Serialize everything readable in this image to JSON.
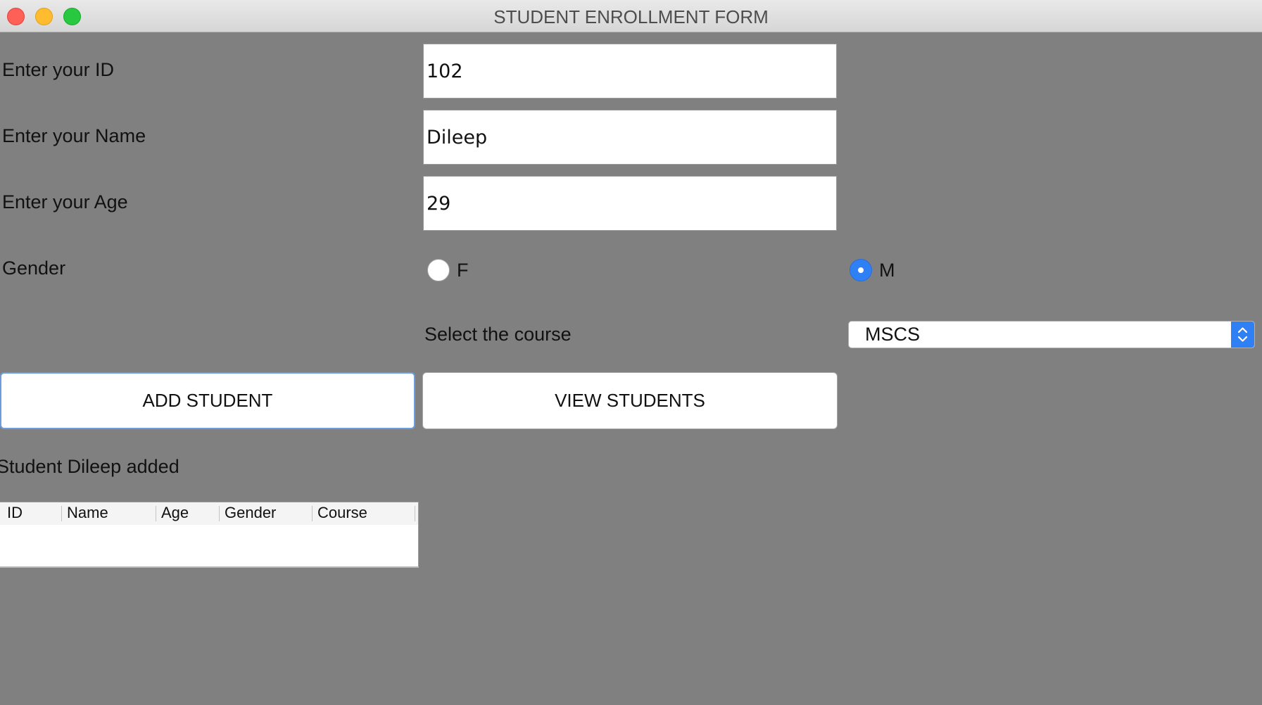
{
  "window": {
    "title": "STUDENT ENROLLMENT FORM"
  },
  "form": {
    "id_label": "Enter your ID",
    "id_value": "102",
    "name_label": "Enter your Name",
    "name_value": "Dileep",
    "age_label": "Enter your Age",
    "age_value": "29",
    "gender_label": "Gender",
    "gender_options": [
      "F",
      "M"
    ],
    "gender_selected": "M",
    "course_label": "Select the course",
    "course_value": "MSCS"
  },
  "buttons": {
    "add_label": "ADD STUDENT",
    "view_label": "VIEW STUDENTS"
  },
  "status": {
    "message": "Student Dileep added"
  },
  "table": {
    "columns": [
      "ID",
      "Name",
      "Age",
      "Gender",
      "Course"
    ],
    "rows": []
  },
  "colors": {
    "background": "#808080",
    "accent": "#2f7ff5"
  }
}
